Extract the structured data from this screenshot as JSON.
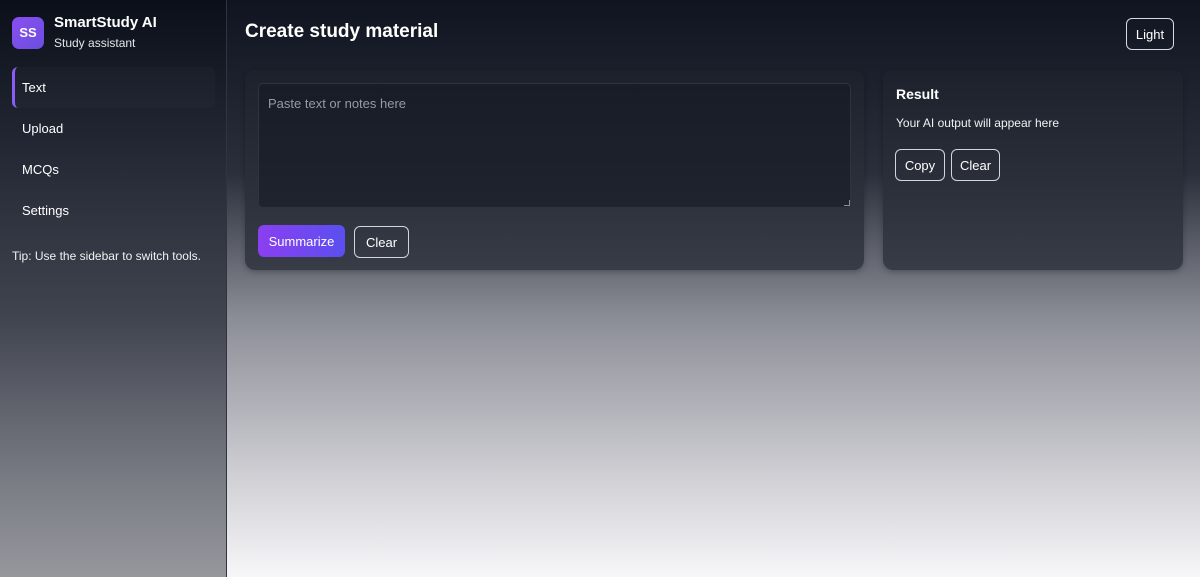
{
  "brand": {
    "logo_text": "SS",
    "title": "SmartStudy AI",
    "subtitle": "Study assistant"
  },
  "sidebar": {
    "items": [
      {
        "label": "Text",
        "active": true
      },
      {
        "label": "Upload",
        "active": false
      },
      {
        "label": "MCQs",
        "active": false
      },
      {
        "label": "Settings",
        "active": false
      }
    ],
    "tip": "Tip: Use the sidebar to switch tools."
  },
  "header": {
    "title": "Create study material",
    "theme_button": "Light"
  },
  "input_card": {
    "placeholder": "Paste text or notes here",
    "value": "",
    "summarize_button": "Summarize",
    "clear_button": "Clear"
  },
  "result_card": {
    "title": "Result",
    "output_text": "Your AI output will appear here",
    "copy_button": "Copy",
    "clear_button": "Clear"
  },
  "colors": {
    "accent": "#8a5cf6",
    "primary_gradient_start": "#8a3ff0",
    "primary_gradient_end": "#5b4ff0"
  }
}
